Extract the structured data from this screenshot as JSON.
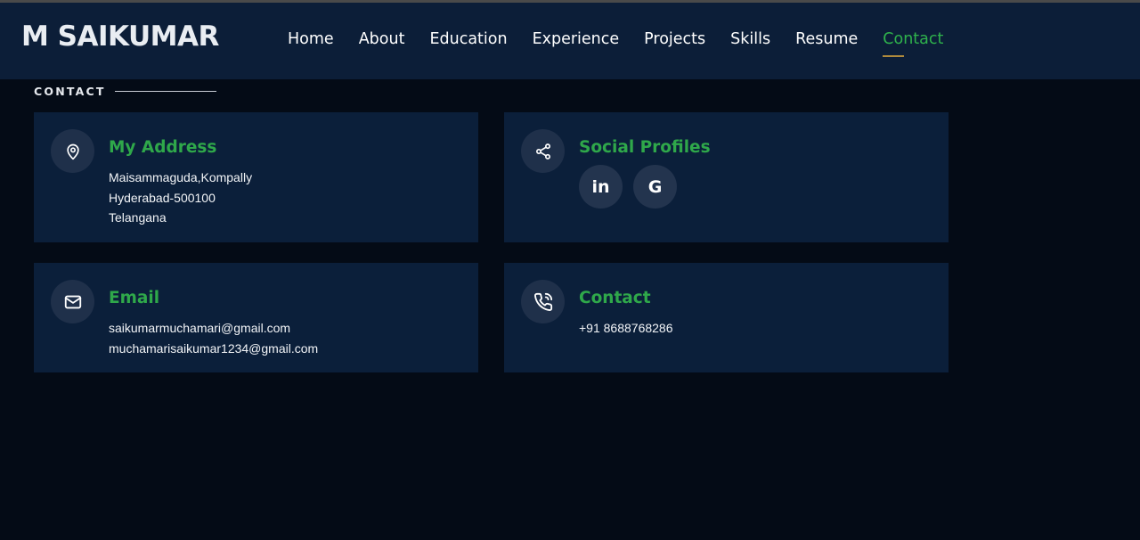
{
  "header": {
    "logo": "M SAIKUMAR",
    "nav": [
      "Home",
      "About",
      "Education",
      "Experience",
      "Projects",
      "Skills",
      "Resume",
      "Contact"
    ],
    "active_nav": "Contact"
  },
  "section": {
    "label": "CONTACT"
  },
  "cards": {
    "address": {
      "title": "My Address",
      "icon": "map-pin-icon",
      "lines": [
        "Maisammaguda,Kompally",
        "Hyderabad-500100",
        "Telangana"
      ]
    },
    "social": {
      "title": "Social Profiles",
      "icon": "share-icon",
      "links": [
        "in",
        "G"
      ]
    },
    "email": {
      "title": "Email",
      "icon": "envelope-icon",
      "lines": [
        "saikumarmuchamari@gmail.com",
        "muchamarisaikumar1234@gmail.com"
      ]
    },
    "contact": {
      "title": "Contact",
      "icon": "phone-icon",
      "lines": [
        "+91 8688768286"
      ]
    }
  },
  "colors": {
    "accent": "#2fa84a",
    "header_bg": "#0c1e38",
    "card_bg": "#0b1f3a",
    "page_bg": "#040b16"
  }
}
